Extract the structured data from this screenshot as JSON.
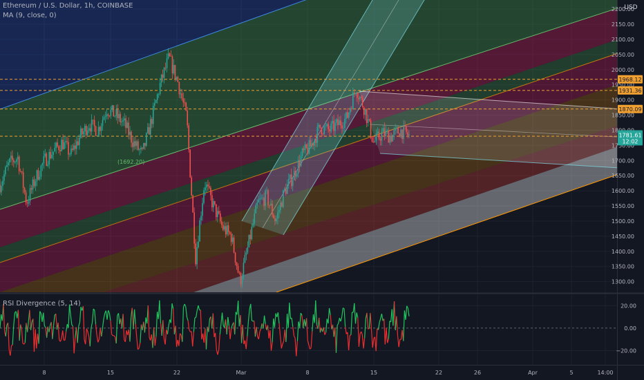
{
  "header": {
    "symbol_line": "Ethereum / U.S. Dollar, 1h, COINBASE",
    "ma_line": "MA (9, close, 0)",
    "currency": "USD"
  },
  "colors": {
    "background": "#131722",
    "grid": "#1e2230",
    "price_up": "#26a69a",
    "price_down": "#ef5350",
    "rsi_up": "#22c55e",
    "rsi_down": "#ef2f2f",
    "level_line": "#f0a030",
    "current_price_badge": "#26a69a"
  },
  "chart_data": {
    "type": "candlestick",
    "title": "Ethereum / U.S. Dollar, 1h, COINBASE",
    "indicator": "MA (9, close, 0)",
    "y_axis": {
      "unit": "USD",
      "ticks": [
        "2200.00",
        "2150.00",
        "2100.00",
        "2050.00",
        "2000.00",
        "1950.00",
        "1900.00",
        "1850.00",
        "1800.00",
        "1750.00",
        "1700.00",
        "1650.00",
        "1600.00",
        "1550.00",
        "1500.00",
        "1450.00",
        "1400.00",
        "1350.00",
        "1300.00"
      ],
      "range": [
        1265,
        2230
      ]
    },
    "x_axis": {
      "ticks": [
        "8",
        "15",
        "22",
        "Mar",
        "8",
        "15",
        "22",
        "26",
        "Apr",
        "5",
        "14:00"
      ]
    },
    "price_levels": [
      {
        "label": "1968.12",
        "value": 1968.12
      },
      {
        "label": "1931.36",
        "value": 1931.36
      },
      {
        "label": "1870.09",
        "value": 1870.09
      },
      {
        "label": "1780.24",
        "value": 1780.24
      }
    ],
    "current_price": {
      "price": "1781.61",
      "countdown": "12:02",
      "value": 1781.61
    },
    "annotation": "(1692.20)",
    "price_path": [
      {
        "date": "Feb 1",
        "value": 1620
      },
      {
        "date": "Feb 2",
        "value": 1690
      },
      {
        "date": "Feb 3",
        "value": 1710
      },
      {
        "date": "Feb 4",
        "value": 1560
      },
      {
        "date": "Feb 5",
        "value": 1640
      },
      {
        "date": "Feb 6",
        "value": 1700
      },
      {
        "date": "Feb 7",
        "value": 1730
      },
      {
        "date": "Feb 8",
        "value": 1760
      },
      {
        "date": "Feb 9",
        "value": 1720
      },
      {
        "date": "Feb 10",
        "value": 1780
      },
      {
        "date": "Feb 11",
        "value": 1820
      },
      {
        "date": "Feb 12",
        "value": 1800
      },
      {
        "date": "Feb 13",
        "value": 1870
      },
      {
        "date": "Feb 14",
        "value": 1850
      },
      {
        "date": "Feb 15",
        "value": 1820
      },
      {
        "date": "Feb 16",
        "value": 1760
      },
      {
        "date": "Feb 17",
        "value": 1720
      },
      {
        "date": "Feb 18",
        "value": 1830
      },
      {
        "date": "Feb 19",
        "value": 1950
      },
      {
        "date": "Feb 20",
        "value": 2040
      },
      {
        "date": "Feb 21",
        "value": 1960
      },
      {
        "date": "Feb 22",
        "value": 1840
      },
      {
        "date": "Feb 23",
        "value": 1380
      },
      {
        "date": "Feb 24",
        "value": 1630
      },
      {
        "date": "Feb 25",
        "value": 1550
      },
      {
        "date": "Feb 26",
        "value": 1480
      },
      {
        "date": "Feb 27",
        "value": 1450
      },
      {
        "date": "Feb 28",
        "value": 1300
      },
      {
        "date": "Mar 1",
        "value": 1430
      },
      {
        "date": "Mar 2",
        "value": 1560
      },
      {
        "date": "Mar 3",
        "value": 1580
      },
      {
        "date": "Mar 4",
        "value": 1500
      },
      {
        "date": "Mar 5",
        "value": 1600
      },
      {
        "date": "Mar 6",
        "value": 1650
      },
      {
        "date": "Mar 7",
        "value": 1720
      },
      {
        "date": "Mar 8",
        "value": 1750
      },
      {
        "date": "Mar 9",
        "value": 1810
      },
      {
        "date": "Mar 10",
        "value": 1800
      },
      {
        "date": "Mar 11",
        "value": 1820
      },
      {
        "date": "Mar 12",
        "value": 1840
      },
      {
        "date": "Mar 13",
        "value": 1940
      },
      {
        "date": "Mar 14",
        "value": 1870
      },
      {
        "date": "Mar 15",
        "value": 1760
      },
      {
        "date": "Mar 16",
        "value": 1790
      },
      {
        "date": "Mar 17",
        "value": 1780
      },
      {
        "date": "Mar 18",
        "value": 1800
      },
      {
        "date": "Mar 19",
        "value": 1782
      }
    ],
    "rsi_panel": {
      "title": "RSI Divergence (5, 14)",
      "ticks": [
        "20.00",
        "0.00",
        "−20.00"
      ],
      "tick_values": [
        20,
        0,
        -20
      ],
      "range": [
        -32,
        30
      ]
    }
  }
}
